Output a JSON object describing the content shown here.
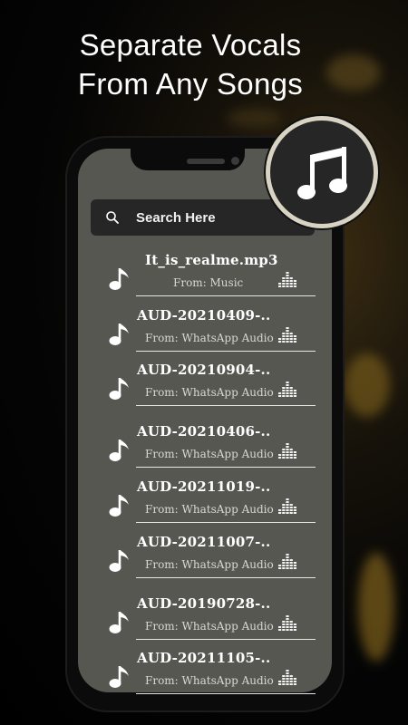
{
  "headline": {
    "line1": "Separate Vocals",
    "line2": "From Any Songs"
  },
  "search": {
    "placeholder": "Search Here",
    "icon": "search-icon"
  },
  "songs": [
    {
      "title": "It_is_realme.mp3",
      "source": "From: Music"
    },
    {
      "title": "AUD-20210409-..",
      "source": "From: WhatsApp Audio"
    },
    {
      "title": "AUD-20210904-..",
      "source": "From: WhatsApp Audio"
    },
    {
      "title": "AUD-20210406-..",
      "source": "From: WhatsApp Audio"
    },
    {
      "title": "AUD-20211019-..",
      "source": "From: WhatsApp Audio"
    },
    {
      "title": "AUD-20211007-..",
      "source": "From: WhatsApp Audio"
    },
    {
      "title": "AUD-20190728-..",
      "source": "From: WhatsApp Audio"
    },
    {
      "title": "AUD-20211105-..",
      "source": "From: WhatsApp Audio"
    }
  ],
  "icons": {
    "song": "music-note-icon",
    "action": "equalizer-icon",
    "badge": "music-notes-icon"
  },
  "colors": {
    "screen": "#575752",
    "search_bar": "#262626",
    "badge_ring": "#d9d3c3"
  }
}
